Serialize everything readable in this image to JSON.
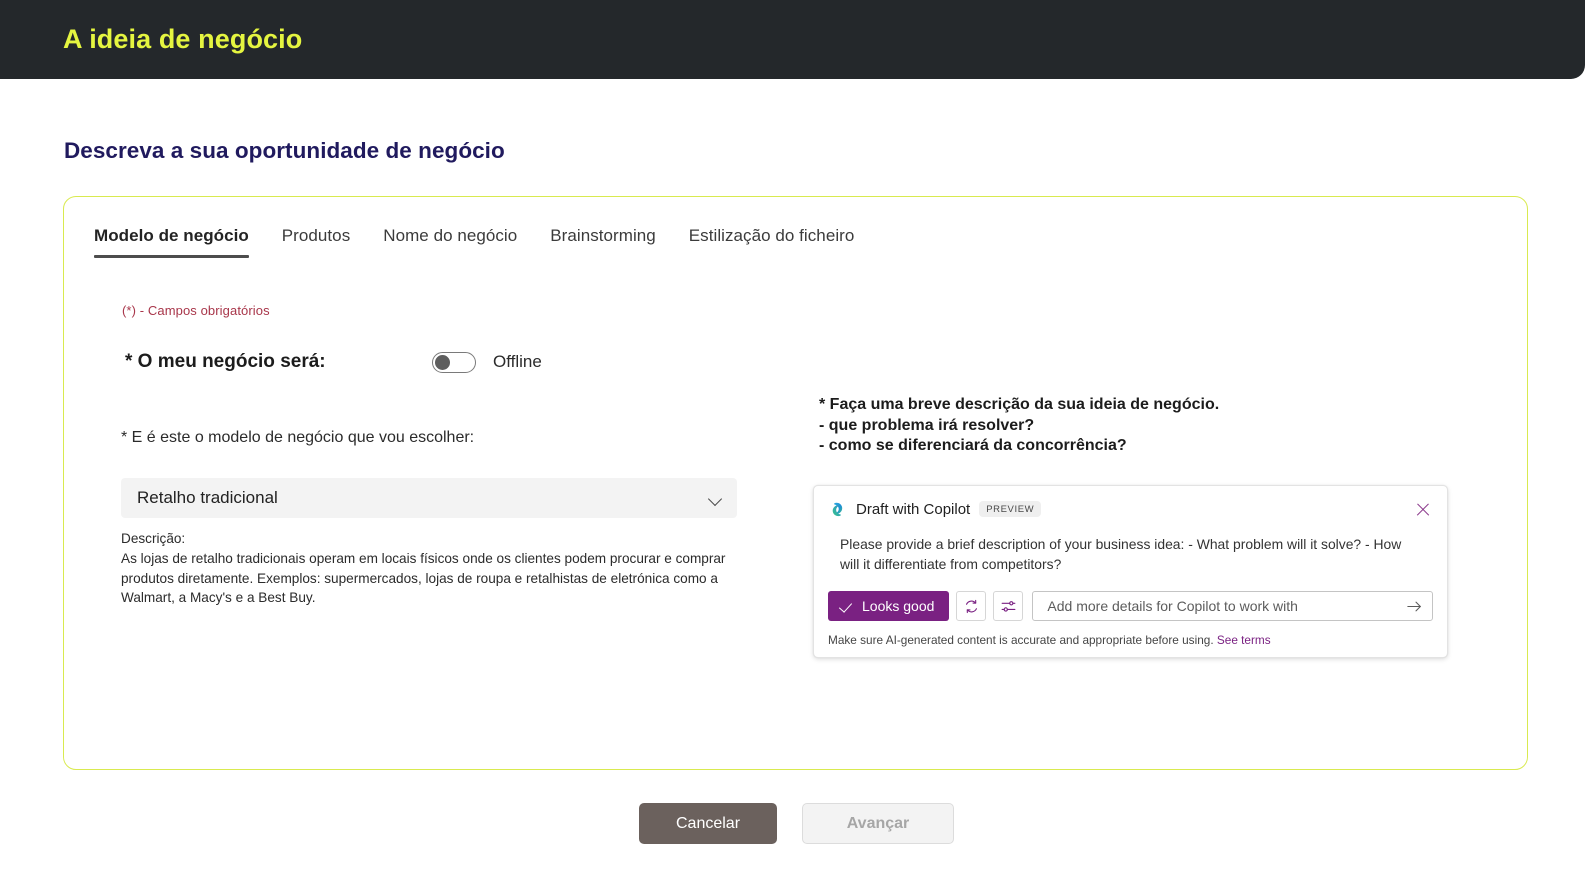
{
  "header": {
    "title": "A ideia de negócio"
  },
  "page": {
    "heading": "Descreva a sua oportunidade de negócio"
  },
  "tabs": [
    {
      "label": "Modelo de negócio",
      "active": true
    },
    {
      "label": "Produtos",
      "active": false
    },
    {
      "label": "Nome do negócio",
      "active": false
    },
    {
      "label": "Brainstorming",
      "active": false
    },
    {
      "label": "Estilização do ficheiro",
      "active": false
    }
  ],
  "form": {
    "required_note": "(*) - Campos obrigatórios",
    "business_type_label": "* O meu negócio será:",
    "toggle_state": "off",
    "toggle_text": "Offline",
    "model_label": "* E é este o modelo de negócio que vou escolher:",
    "model_selected": "Retalho tradicional",
    "description_heading": "Descrição:",
    "description_text": "As lojas de retalho tradicionais operam em locais físicos onde os clientes podem procurar e comprar produtos diretamente. Exemplos: supermercados, lojas de roupa e retalhistas de eletrónica como a Walmart, a Macy's e a Best Buy."
  },
  "prompt": {
    "text": "* Faça uma breve descrição da sua ideia de negócio.\n- que problema irá resolver?\n- como se diferenciará da concorrência?"
  },
  "copilot": {
    "title": "Draft with Copilot",
    "badge": "PREVIEW",
    "draft_text": "Please provide a brief description of your business idea: - What problem will it solve? - How will it differentiate from competitors?",
    "looks_good_label": "Looks good",
    "input_placeholder": "Add more details for Copilot to work with",
    "input_value": "",
    "disclaimer": "Make sure AI-generated content is accurate and appropriate before using.",
    "terms_link": "See terms"
  },
  "footer": {
    "cancel_label": "Cancelar",
    "next_label": "Avançar"
  },
  "colors": {
    "header_bg": "#24282b",
    "header_text": "#e5f540",
    "heading": "#201a5e",
    "card_border": "#d9ea4f",
    "required": "#a8364a",
    "copilot_purple": "#7a2182",
    "cancel_bg": "#6b615d"
  }
}
